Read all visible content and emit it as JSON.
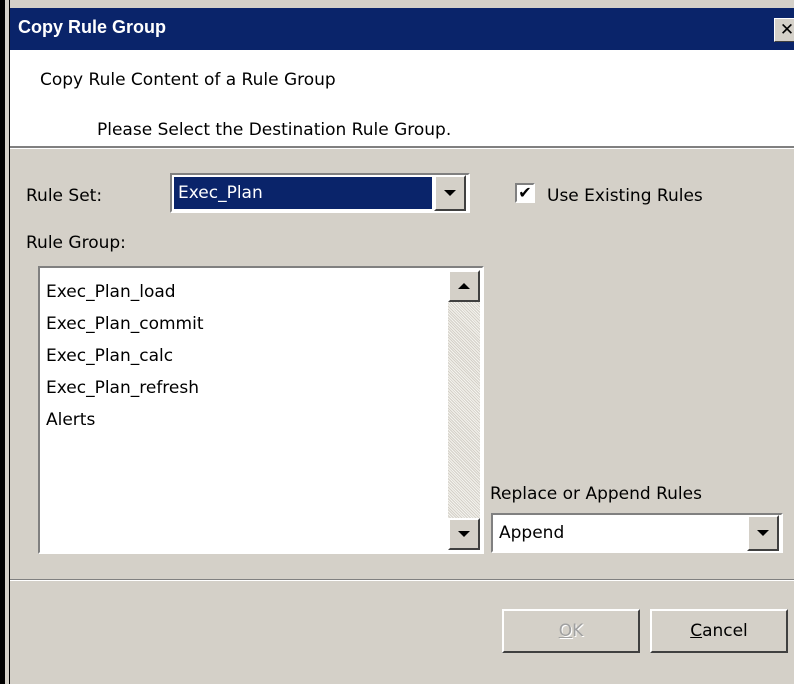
{
  "window": {
    "title": "Copy Rule Group",
    "close_glyph": "✕"
  },
  "header": {
    "heading": "Copy Rule Content of a Rule Group",
    "subheading": "Please Select the Destination Rule Group."
  },
  "form": {
    "rule_set_label": "Rule Set:",
    "rule_set_value": "Exec_Plan",
    "use_existing_label": "Use Existing Rules",
    "use_existing_checked": true,
    "rule_group_label": "Rule Group:",
    "rule_groups": [
      "Exec_Plan_load",
      "Exec_Plan_commit",
      "Exec_Plan_calc",
      "Exec_Plan_refresh",
      "Alerts"
    ],
    "replace_label": "Replace or Append Rules",
    "replace_value": "Append"
  },
  "buttons": {
    "ok_accel": "O",
    "ok_rest": "K",
    "cancel_accel": "C",
    "cancel_rest": "ancel"
  },
  "icons": {
    "close": "close-icon",
    "check": "checkmark-icon",
    "dropdown": "chevron-down-icon",
    "scroll_up": "chevron-up-icon"
  },
  "colors": {
    "title_bar": "#0a246a",
    "dialog_face": "#d4d0c8",
    "selection": "#0a246a"
  }
}
